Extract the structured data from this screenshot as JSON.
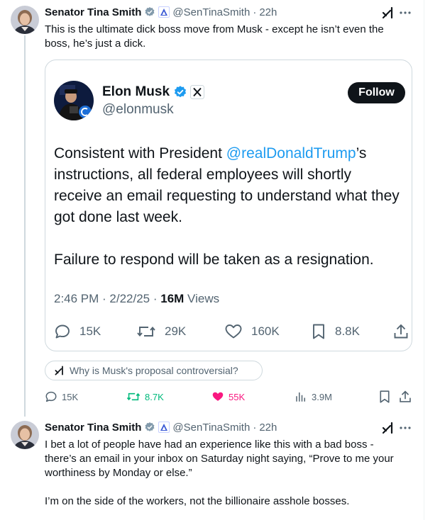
{
  "colors": {
    "accent": "#1d9bf0",
    "verified": "#1d9bf0",
    "retweet": "#00ba7c",
    "like": "#f91880",
    "muted": "#536471"
  },
  "post1": {
    "author_name": "Senator Tina Smith",
    "handle": "@SenTinaSmith",
    "time": "22h",
    "text": "This is the ultimate dick boss move from Musk - except he isn’t even the boss, he’s just a dick.",
    "quote": {
      "author_name": "Elon Musk",
      "handle": "@elonmusk",
      "follow_label": "Follow",
      "text_prefix": "Consistent with President ",
      "mention": "@realDonaldTrump",
      "text_suffix": "’s instructions, all federal employees will shortly receive an email requesting to understand what they got done last week.",
      "text_2": "Failure to respond will be taken as a resignation.",
      "timestamp": "2:46 PM · 2/22/25 · ",
      "views_count": "16M",
      "views_label": " Views",
      "replies": "15K",
      "reposts": "29K",
      "likes": "160K",
      "bookmarks": "8.8K"
    },
    "ask_grok": "Why is Musk's proposal controversial?",
    "replies": "15K",
    "reposts": "8.7K",
    "likes": "55K",
    "views": "3.9M"
  },
  "post2": {
    "author_name": "Senator Tina Smith",
    "handle": "@SenTinaSmith",
    "time": "22h",
    "text_1": "I bet a lot of people have had an experience like this with a bad boss - there’s an email in your inbox on Saturday night saying, “Prove to me your worthiness by Monday or else.”",
    "text_2": "I’m on the side of the workers, not the billionaire asshole bosses."
  }
}
